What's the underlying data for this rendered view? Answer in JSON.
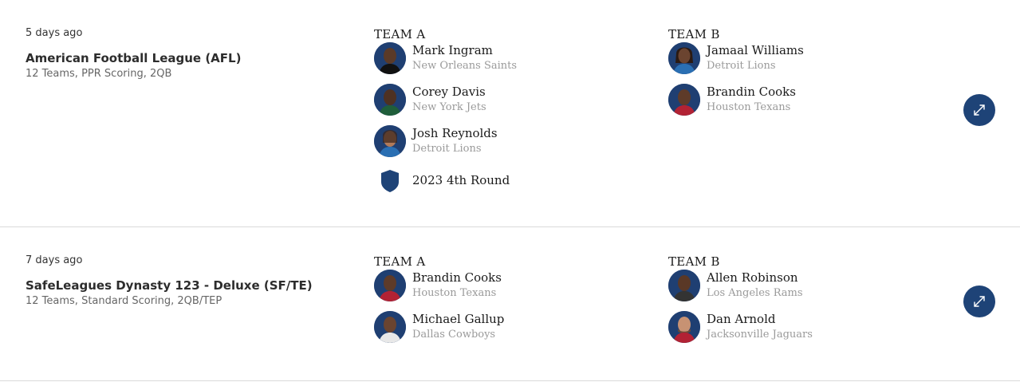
{
  "trades": [
    {
      "time": "5 days ago",
      "league": "American Football League (AFL)",
      "details": "12 Teams, PPR Scoring, 2QB",
      "team_a": {
        "title": "TEAM A",
        "assets": [
          {
            "name": "Mark Ingram",
            "team": "New Orleans Saints",
            "jersey": "#111111"
          },
          {
            "name": "Corey Davis",
            "team": "New York Jets",
            "jersey": "#1f5e3a"
          },
          {
            "name": "Josh Reynolds",
            "team": "Detroit Lions",
            "jersey": "#2a6fb3"
          }
        ],
        "pick": "2023 4th Round"
      },
      "team_b": {
        "title": "TEAM B",
        "assets": [
          {
            "name": "Jamaal Williams",
            "team": "Detroit Lions",
            "jersey": "#2a6fb3"
          },
          {
            "name": "Brandin Cooks",
            "team": "Houston Texans",
            "jersey": "#b22234"
          }
        ]
      }
    },
    {
      "time": "7 days ago",
      "league": "SafeLeagues Dynasty 123 - Deluxe (SF/TE)",
      "details": "12 Teams, Standard Scoring, 2QB/TEP",
      "team_a": {
        "title": "TEAM A",
        "assets": [
          {
            "name": "Brandin Cooks",
            "team": "Houston Texans",
            "jersey": "#b22234"
          },
          {
            "name": "Michael Gallup",
            "team": "Dallas Cowboys",
            "jersey": "#e8e8e8"
          }
        ]
      },
      "team_b": {
        "title": "TEAM B",
        "assets": [
          {
            "name": "Allen Robinson",
            "team": "Los Angeles Rams",
            "jersey": "#333333"
          },
          {
            "name": "Dan Arnold",
            "team": "Jacksonville Jaguars",
            "jersey": "#b22234"
          }
        ]
      }
    }
  ],
  "icons": {
    "expand": "expand-arrows-icon",
    "pick": "shield-icon",
    "avatar": "player-headshot"
  },
  "colors": {
    "accent": "#1e4377",
    "avatar_bg": "#1f3f72"
  }
}
